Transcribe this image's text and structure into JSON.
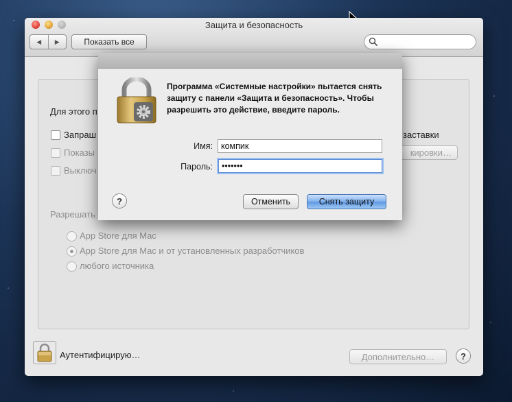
{
  "window": {
    "title": "Защита и безопасность",
    "back_glyph": "◀",
    "forward_glyph": "▶",
    "show_all_label": "Показать все",
    "search_placeholder": ""
  },
  "background_panel": {
    "partial_heading": "Для этого п",
    "checkboxes": [
      {
        "label": "Запраш",
        "enabled": true
      },
      {
        "label": "Показы",
        "enabled": false
      },
      {
        "label": "Выключ",
        "enabled": false
      }
    ],
    "right_label": "заставки",
    "partial_button": "кировки…",
    "allow_heading": "Разрешать",
    "radio_options": [
      {
        "label": "App Store для Mac",
        "selected": false
      },
      {
        "label": "App Store для Mac и от установленных разработчиков",
        "selected": true
      },
      {
        "label": "любого источника",
        "selected": false
      }
    ]
  },
  "footer": {
    "auth_label": "Аутентифицирую…",
    "advanced_button": "Дополнительно…",
    "help_glyph": "?"
  },
  "dialog": {
    "message": "Программа «Системные настройки» пытается снять защиту с панели «Защита и безопасность». Чтобы разрешить это действие, введите пароль.",
    "name_label": "Имя:",
    "name_value": "компик",
    "password_label": "Пароль:",
    "password_value": "•••••••",
    "help_glyph": "?",
    "cancel_label": "Отменить",
    "unlock_label": "Снять защиту"
  },
  "colors": {
    "primary_button": "#5e98e2",
    "focus_ring": "#9cc0f3",
    "lock_gold": "#c9a24a"
  },
  "icons": {
    "lock": "padlock-icon",
    "gear": "gear-icon",
    "search": "magnifier-icon",
    "cursor": "arrow-cursor-icon"
  }
}
